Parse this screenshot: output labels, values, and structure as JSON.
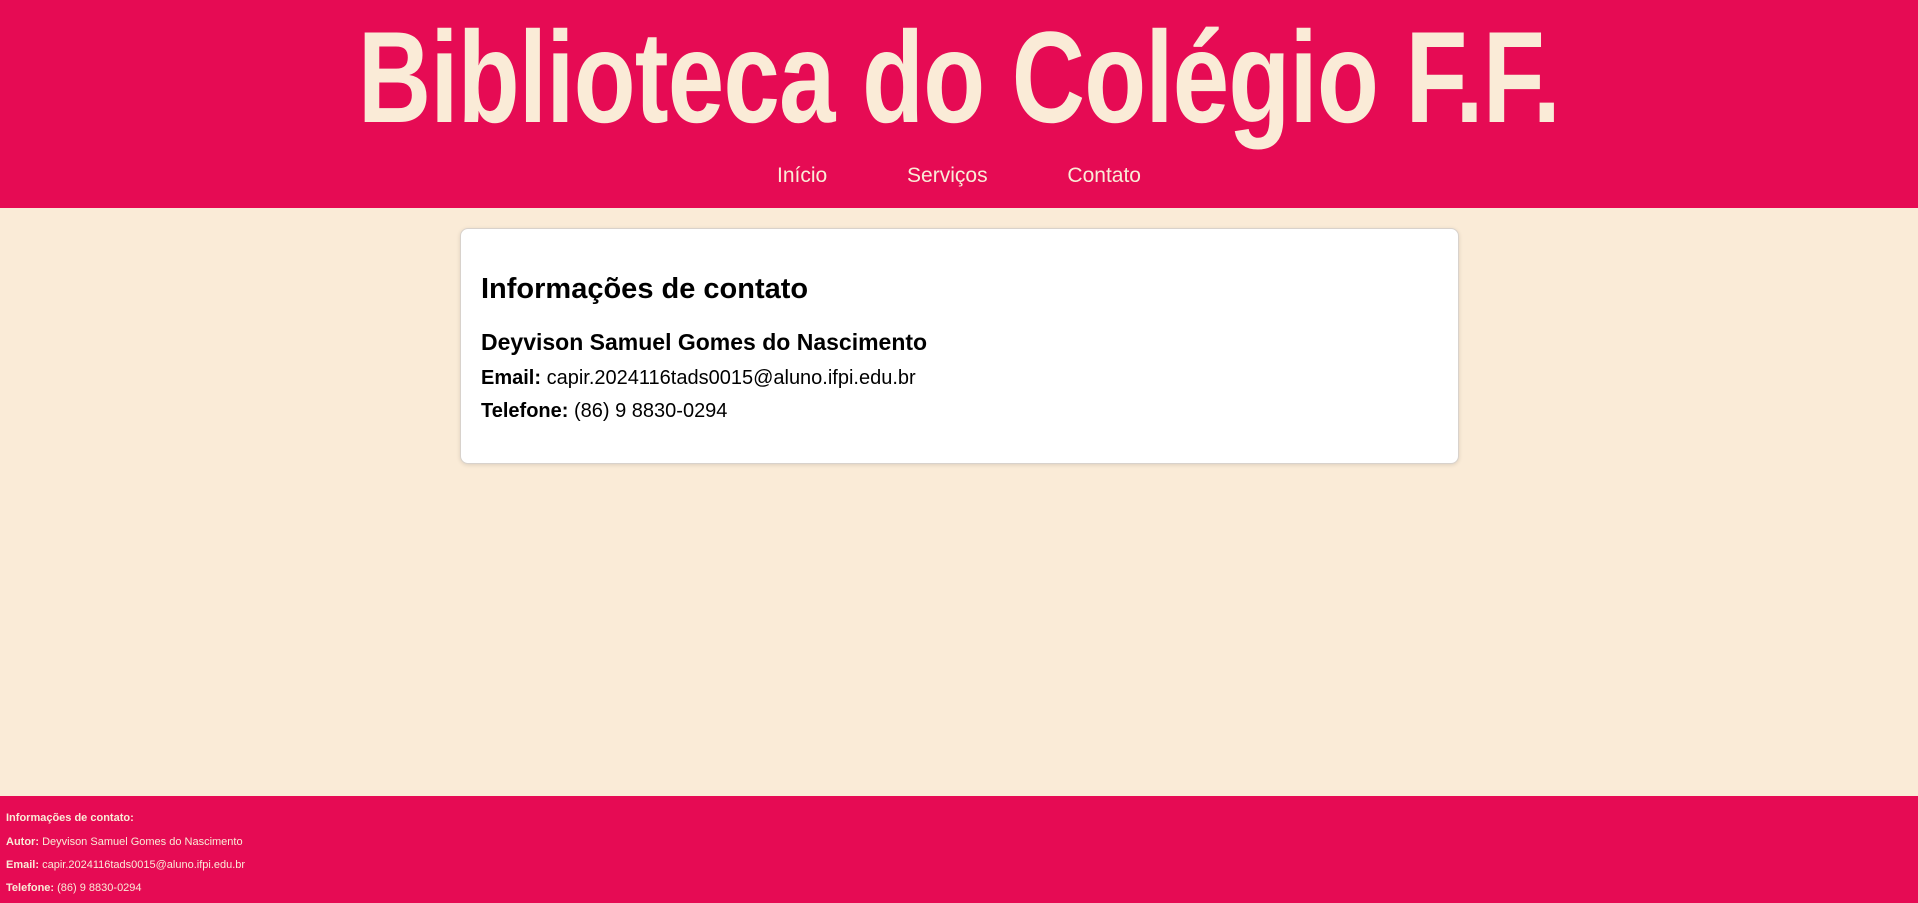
{
  "header": {
    "title": "Biblioteca do Colégio F.F.",
    "nav": [
      "Início",
      "Serviços",
      "Contato"
    ]
  },
  "card": {
    "title": "Informações de contato",
    "author_name": "Deyvison Samuel Gomes do Nascimento",
    "email_label": "Email:",
    "email_value": "capir.2024116tads0015@aluno.ifpi.edu.br",
    "phone_label": "Telefone:",
    "phone_value": "(86) 9 8830-0294"
  },
  "footer": {
    "heading": "Informações de contato:",
    "author_label": "Autor:",
    "author_value": "Deyvison Samuel Gomes do Nascimento",
    "email_label": "Email:",
    "email_value": "capir.2024116tads0015@aluno.ifpi.edu.br",
    "phone_label": "Telefone:",
    "phone_value": "(86) 9 8830-0294"
  },
  "colors": {
    "accent": "#e60b54",
    "background": "#faebd7",
    "card": "#ffffff"
  }
}
